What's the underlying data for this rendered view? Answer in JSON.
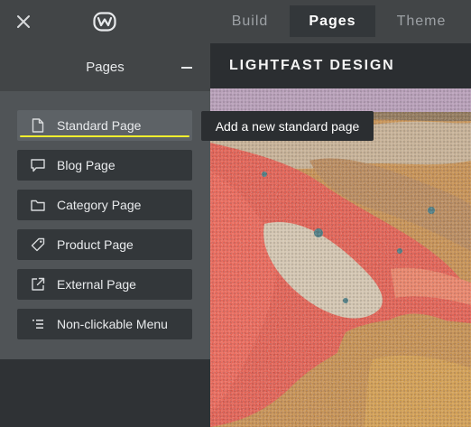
{
  "topbar": {
    "close_icon": "close-icon",
    "logo_icon": "weebly-logo-icon",
    "tabs": [
      {
        "label": "Build",
        "active": false
      },
      {
        "label": "Pages",
        "active": true
      },
      {
        "label": "Theme",
        "active": false
      }
    ]
  },
  "sidebar": {
    "title": "Pages",
    "collapse_icon": "minus-icon",
    "items": [
      {
        "label": "Standard Page",
        "icon": "page-icon",
        "active": true
      },
      {
        "label": "Blog Page",
        "icon": "comment-icon",
        "active": false
      },
      {
        "label": "Category Page",
        "icon": "folder-icon",
        "active": false
      },
      {
        "label": "Product Page",
        "icon": "tag-icon",
        "active": false
      },
      {
        "label": "External Page",
        "icon": "external-link-icon",
        "active": false
      },
      {
        "label": "Non-clickable Menu",
        "icon": "menu-list-icon",
        "active": false
      }
    ]
  },
  "tooltip": {
    "text": "Add a new standard page"
  },
  "preview": {
    "site_title": "LIGHTFAST DESIGN"
  },
  "colors": {
    "topbar": "#424547",
    "sidebar": "#505457",
    "item_bg": "#33373a",
    "highlight": "#f2ee2e",
    "tooltip_bg": "#2b2e31"
  }
}
